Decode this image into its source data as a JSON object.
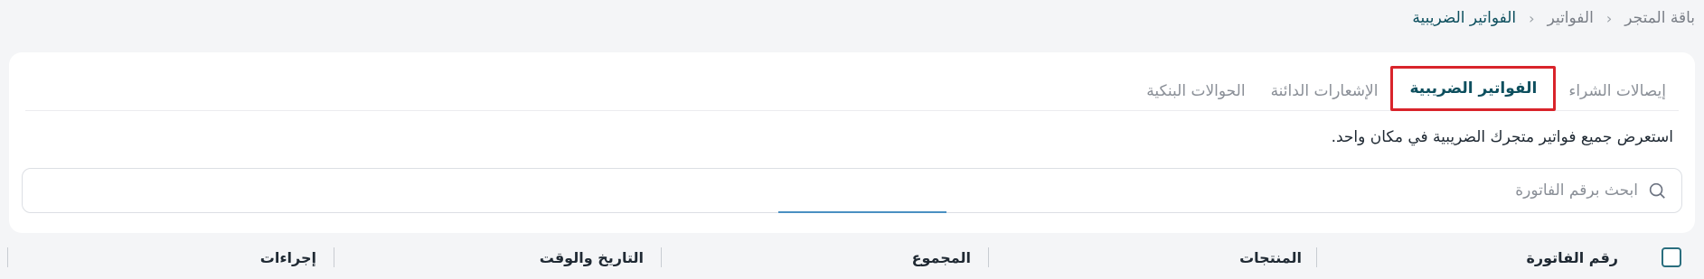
{
  "breadcrumb": {
    "items": [
      "باقة المتجر",
      "الفواتير",
      "الفواتير الضريبية"
    ],
    "separator": "<"
  },
  "tabs": [
    {
      "label": "إيصالات الشراء",
      "active": false
    },
    {
      "label": "الفواتير الضريبية",
      "active": true
    },
    {
      "label": "الإشعارات الدائنة",
      "active": false
    },
    {
      "label": "الحوالات البنكية",
      "active": false
    }
  ],
  "description": "استعرض جميع فواتير متجرك الضريبية في مكان واحد.",
  "search": {
    "placeholder": "ابحث برقم الفاتورة",
    "value": "",
    "icon": "search-icon"
  },
  "table": {
    "columns": [
      "رقم الفاتورة",
      "المنتجات",
      "المجموع",
      "التاريخ والوقت",
      "إجراءات"
    ]
  },
  "colors": {
    "accent": "#0d4f5e",
    "highlight_border": "#d9242b",
    "background": "#f4f5f7"
  }
}
